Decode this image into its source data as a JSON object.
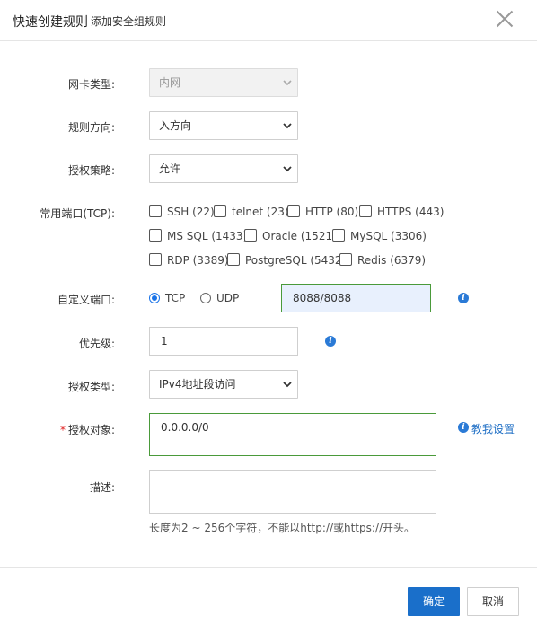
{
  "header": {
    "title": "快速创建规则",
    "subtitle": "添加安全组规则"
  },
  "form": {
    "nic_type": {
      "label": "网卡类型:",
      "value": "内网"
    },
    "direction": {
      "label": "规则方向:",
      "value": "入方向"
    },
    "policy": {
      "label": "授权策略:",
      "value": "允许"
    },
    "common_ports": {
      "label": "常用端口(TCP):",
      "options": [
        "SSH (22)",
        "telnet (23)",
        "HTTP (80)",
        "HTTPS (443)",
        "MS SQL (1433)",
        "Oracle (1521)",
        "MySQL (3306)",
        "RDP (3389)",
        "PostgreSQL (5432)",
        "Redis (6379)"
      ]
    },
    "custom_port": {
      "label": "自定义端口:",
      "tcp": "TCP",
      "udp": "UDP",
      "value": "8088/8088"
    },
    "priority": {
      "label": "优先级:",
      "value": "1"
    },
    "auth_type": {
      "label": "授权类型:",
      "value": "IPv4地址段访问"
    },
    "auth_object": {
      "required_mark": "*",
      "label": "授权对象:",
      "value": "0.0.0.0/0",
      "help": "教我设置"
    },
    "description": {
      "label": "描述:",
      "value": "",
      "hint": "长度为2 ~ 256个字符，不能以http://或https://开头。"
    }
  },
  "footer": {
    "confirm": "确定",
    "cancel": "取消"
  },
  "colors": {
    "primary": "#1a6fca",
    "focus_green": "#4a9a3a",
    "info_blue": "#2a7ad6"
  }
}
